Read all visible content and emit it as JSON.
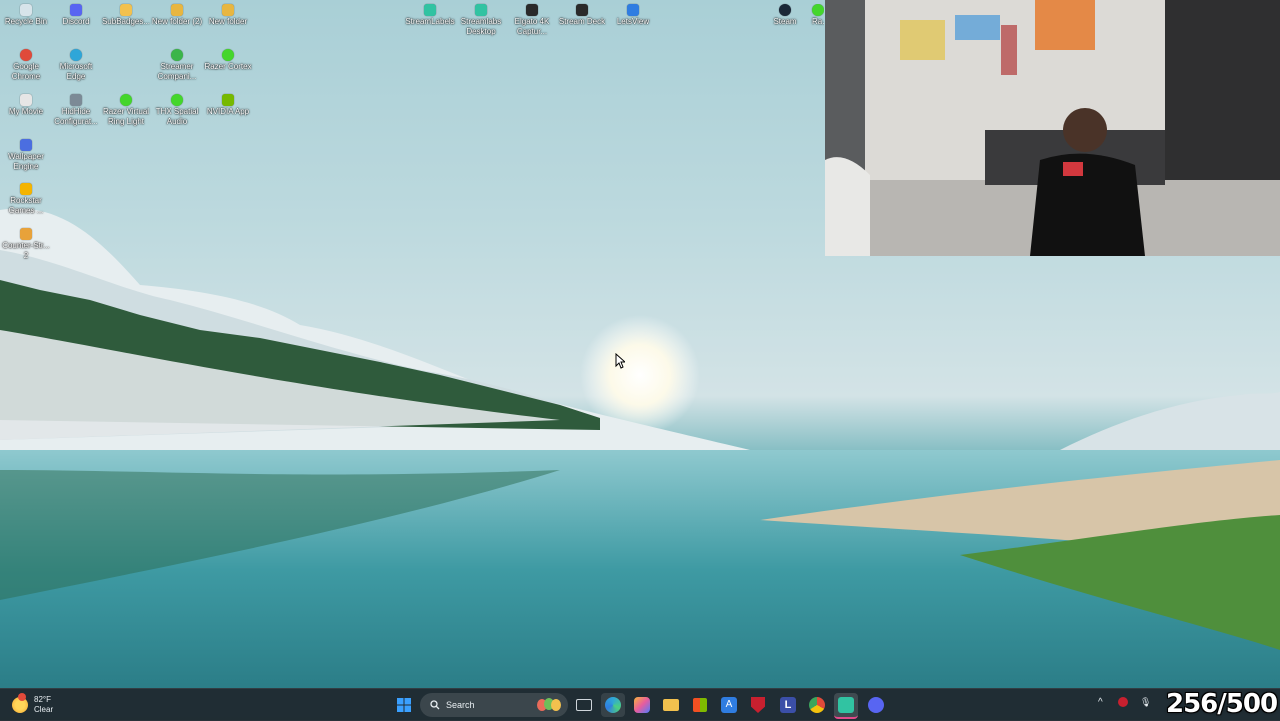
{
  "desktop": {
    "icons": [
      {
        "label": "Recycle Bin",
        "color": "#d7e4ea"
      },
      {
        "label": "Discord",
        "color": "#5865f2"
      },
      {
        "label": "SubBadges...",
        "color": "#f2c14e"
      },
      {
        "label": "New folder (2)",
        "color": "#e8b640"
      },
      {
        "label": "New folder",
        "color": "#e8b640"
      },
      {
        "label": "Google Chrome",
        "color": "#e04a3a"
      },
      {
        "label": "Microsoft Edge",
        "color": "#2fa6d8"
      },
      {
        "label": "Streamer Compani...",
        "color": "#3bb54a"
      },
      {
        "label": "Razer Cortex",
        "color": "#44d62c"
      },
      {
        "label": "My Movie",
        "color": "#e6e6e6"
      },
      {
        "label": "HidHide Configurat...",
        "color": "#7c8a96"
      },
      {
        "label": "Razer Virtual Ring Light",
        "color": "#44d62c"
      },
      {
        "label": "THX Spatial Audio",
        "color": "#44d62c"
      },
      {
        "label": "NVIDIA App",
        "color": "#76b900"
      },
      {
        "label": "Wallpaper Engine",
        "color": "#4b6ee0"
      },
      {
        "label": "Rockstar Games ...",
        "color": "#f4b400"
      },
      {
        "label": "Counter-Str... 2",
        "color": "#e8a23a"
      },
      {
        "label": "StreamLabels",
        "color": "#31c3a2"
      },
      {
        "label": "Streamlabs Desktop",
        "color": "#31c3a2"
      },
      {
        "label": "Elgato 4K Captur...",
        "color": "#2a2a2a"
      },
      {
        "label": "Stream Deck",
        "color": "#2a2a2a"
      },
      {
        "label": "LetsView",
        "color": "#2f7de1"
      },
      {
        "label": "Steam",
        "color": "#1b2838"
      },
      {
        "label": "Ra...",
        "color": "#44d62c"
      }
    ]
  },
  "taskbar": {
    "weather": {
      "temp": "82°F",
      "condition": "Clear"
    },
    "search_label": "Search",
    "apps": [
      {
        "name": "start-icon",
        "glyph": "⊞",
        "color": "#3aa0ff"
      },
      {
        "name": "task-view-icon",
        "glyph": "▭",
        "color": "#d9d9d9"
      },
      {
        "name": "edge-icon",
        "glyph": "e",
        "color": "#2fa6d8"
      },
      {
        "name": "copilot-icon",
        "glyph": "✦",
        "color": "#7b61ff"
      },
      {
        "name": "file-explorer-icon",
        "glyph": "▰",
        "color": "#f2c14e"
      },
      {
        "name": "store-icon",
        "glyph": "▣",
        "color": "#e8e8e8"
      },
      {
        "name": "azure-icon",
        "glyph": "A",
        "color": "#2f7de1"
      },
      {
        "name": "mcafee-icon",
        "glyph": "M",
        "color": "#c8202f"
      },
      {
        "name": "l-app-icon",
        "glyph": "L",
        "color": "#3b4fa8"
      },
      {
        "name": "chrome-icon",
        "glyph": "◉",
        "color": "#e04a3a"
      },
      {
        "name": "streamlabs-icon",
        "glyph": "◙",
        "color": "#31c3a2"
      },
      {
        "name": "discord-icon",
        "glyph": "◕",
        "color": "#5865f2"
      }
    ],
    "tray": {
      "chevron": "^",
      "mic": "🎙"
    }
  },
  "overlay": {
    "counter": "256/500"
  }
}
